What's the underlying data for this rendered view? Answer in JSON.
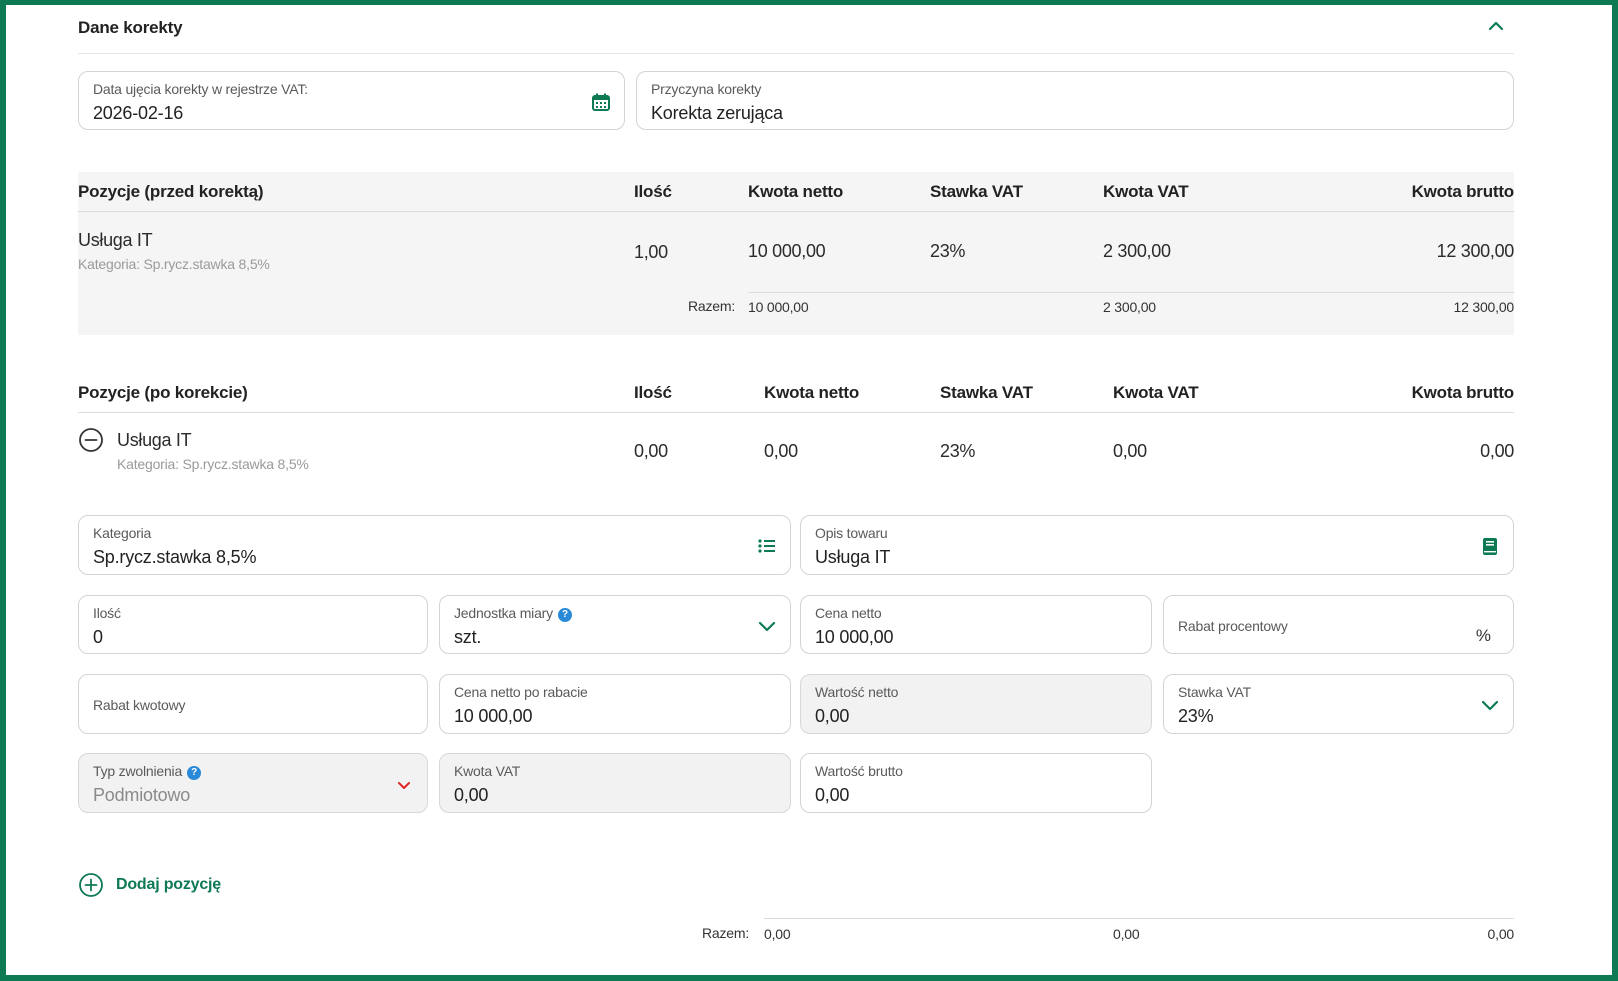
{
  "section": {
    "title": "Dane korekty",
    "collapse_icon": "chevron-up-icon"
  },
  "correction_date": {
    "label": "Data ujęcia korekty w rejestrze VAT:",
    "value": "2026-02-16",
    "icon": "calendar-icon"
  },
  "correction_reason": {
    "label": "Przyczyna korekty",
    "value": "Korekta zerująca"
  },
  "before": {
    "headers": {
      "name": "Pozycje (przed korektą)",
      "qty": "Ilość",
      "net": "Kwota netto",
      "rate": "Stawka VAT",
      "vat": "Kwota VAT",
      "gross": "Kwota brutto"
    },
    "rows": [
      {
        "name": "Usługa IT",
        "category": "Kategoria: Sp.rycz.stawka 8,5%",
        "qty": "1,00",
        "net": "10 000,00",
        "rate": "23%",
        "vat": "2 300,00",
        "gross": "12 300,00"
      }
    ],
    "total": {
      "label": "Razem:",
      "net": "10 000,00",
      "vat": "2 300,00",
      "gross": "12 300,00"
    }
  },
  "after": {
    "headers": {
      "name": "Pozycje (po korekcie)",
      "qty": "Ilość",
      "net": "Kwota netto",
      "rate": "Stawka VAT",
      "vat": "Kwota VAT",
      "gross": "Kwota brutto"
    },
    "rows": [
      {
        "name": "Usługa IT",
        "category": "Kategoria: Sp.rycz.stawka 8,5%",
        "qty": "0,00",
        "net": "0,00",
        "rate": "23%",
        "vat": "0,00",
        "gross": "0,00"
      }
    ],
    "total": {
      "label": "Razem:",
      "net": "0,00",
      "vat": "0,00",
      "gross": "0,00"
    }
  },
  "form": {
    "kategoria": {
      "label": "Kategoria",
      "value": "Sp.rycz.stawka 8,5%"
    },
    "opis": {
      "label": "Opis towaru",
      "value": "Usługa IT"
    },
    "ilosc": {
      "label": "Ilość",
      "value": "0"
    },
    "jednostka": {
      "label": "Jednostka miary",
      "value": "szt."
    },
    "cena_netto": {
      "label": "Cena netto",
      "value": "10 000,00"
    },
    "rabat_procentowy": {
      "label": "Rabat procentowy",
      "suffix": "%"
    },
    "rabat_kwotowy": {
      "label": "Rabat kwotowy"
    },
    "cena_po_rabacie": {
      "label": "Cena netto po rabacie",
      "value": "10 000,00"
    },
    "wartosc_netto": {
      "label": "Wartość netto",
      "value": "0,00"
    },
    "stawka_vat": {
      "label": "Stawka VAT",
      "value": "23%"
    },
    "typ_zwolnienia": {
      "label": "Typ zwolnienia",
      "value": "Podmiotowo"
    },
    "kwota_vat": {
      "label": "Kwota VAT",
      "value": "0,00"
    },
    "wartosc_brutto": {
      "label": "Wartość brutto",
      "value": "0,00"
    }
  },
  "add_position": {
    "label": "Dodaj pozycję"
  },
  "colors": {
    "accent": "#0d7a54",
    "help": "#2a8ad8",
    "error_chevron": "#e02424"
  }
}
